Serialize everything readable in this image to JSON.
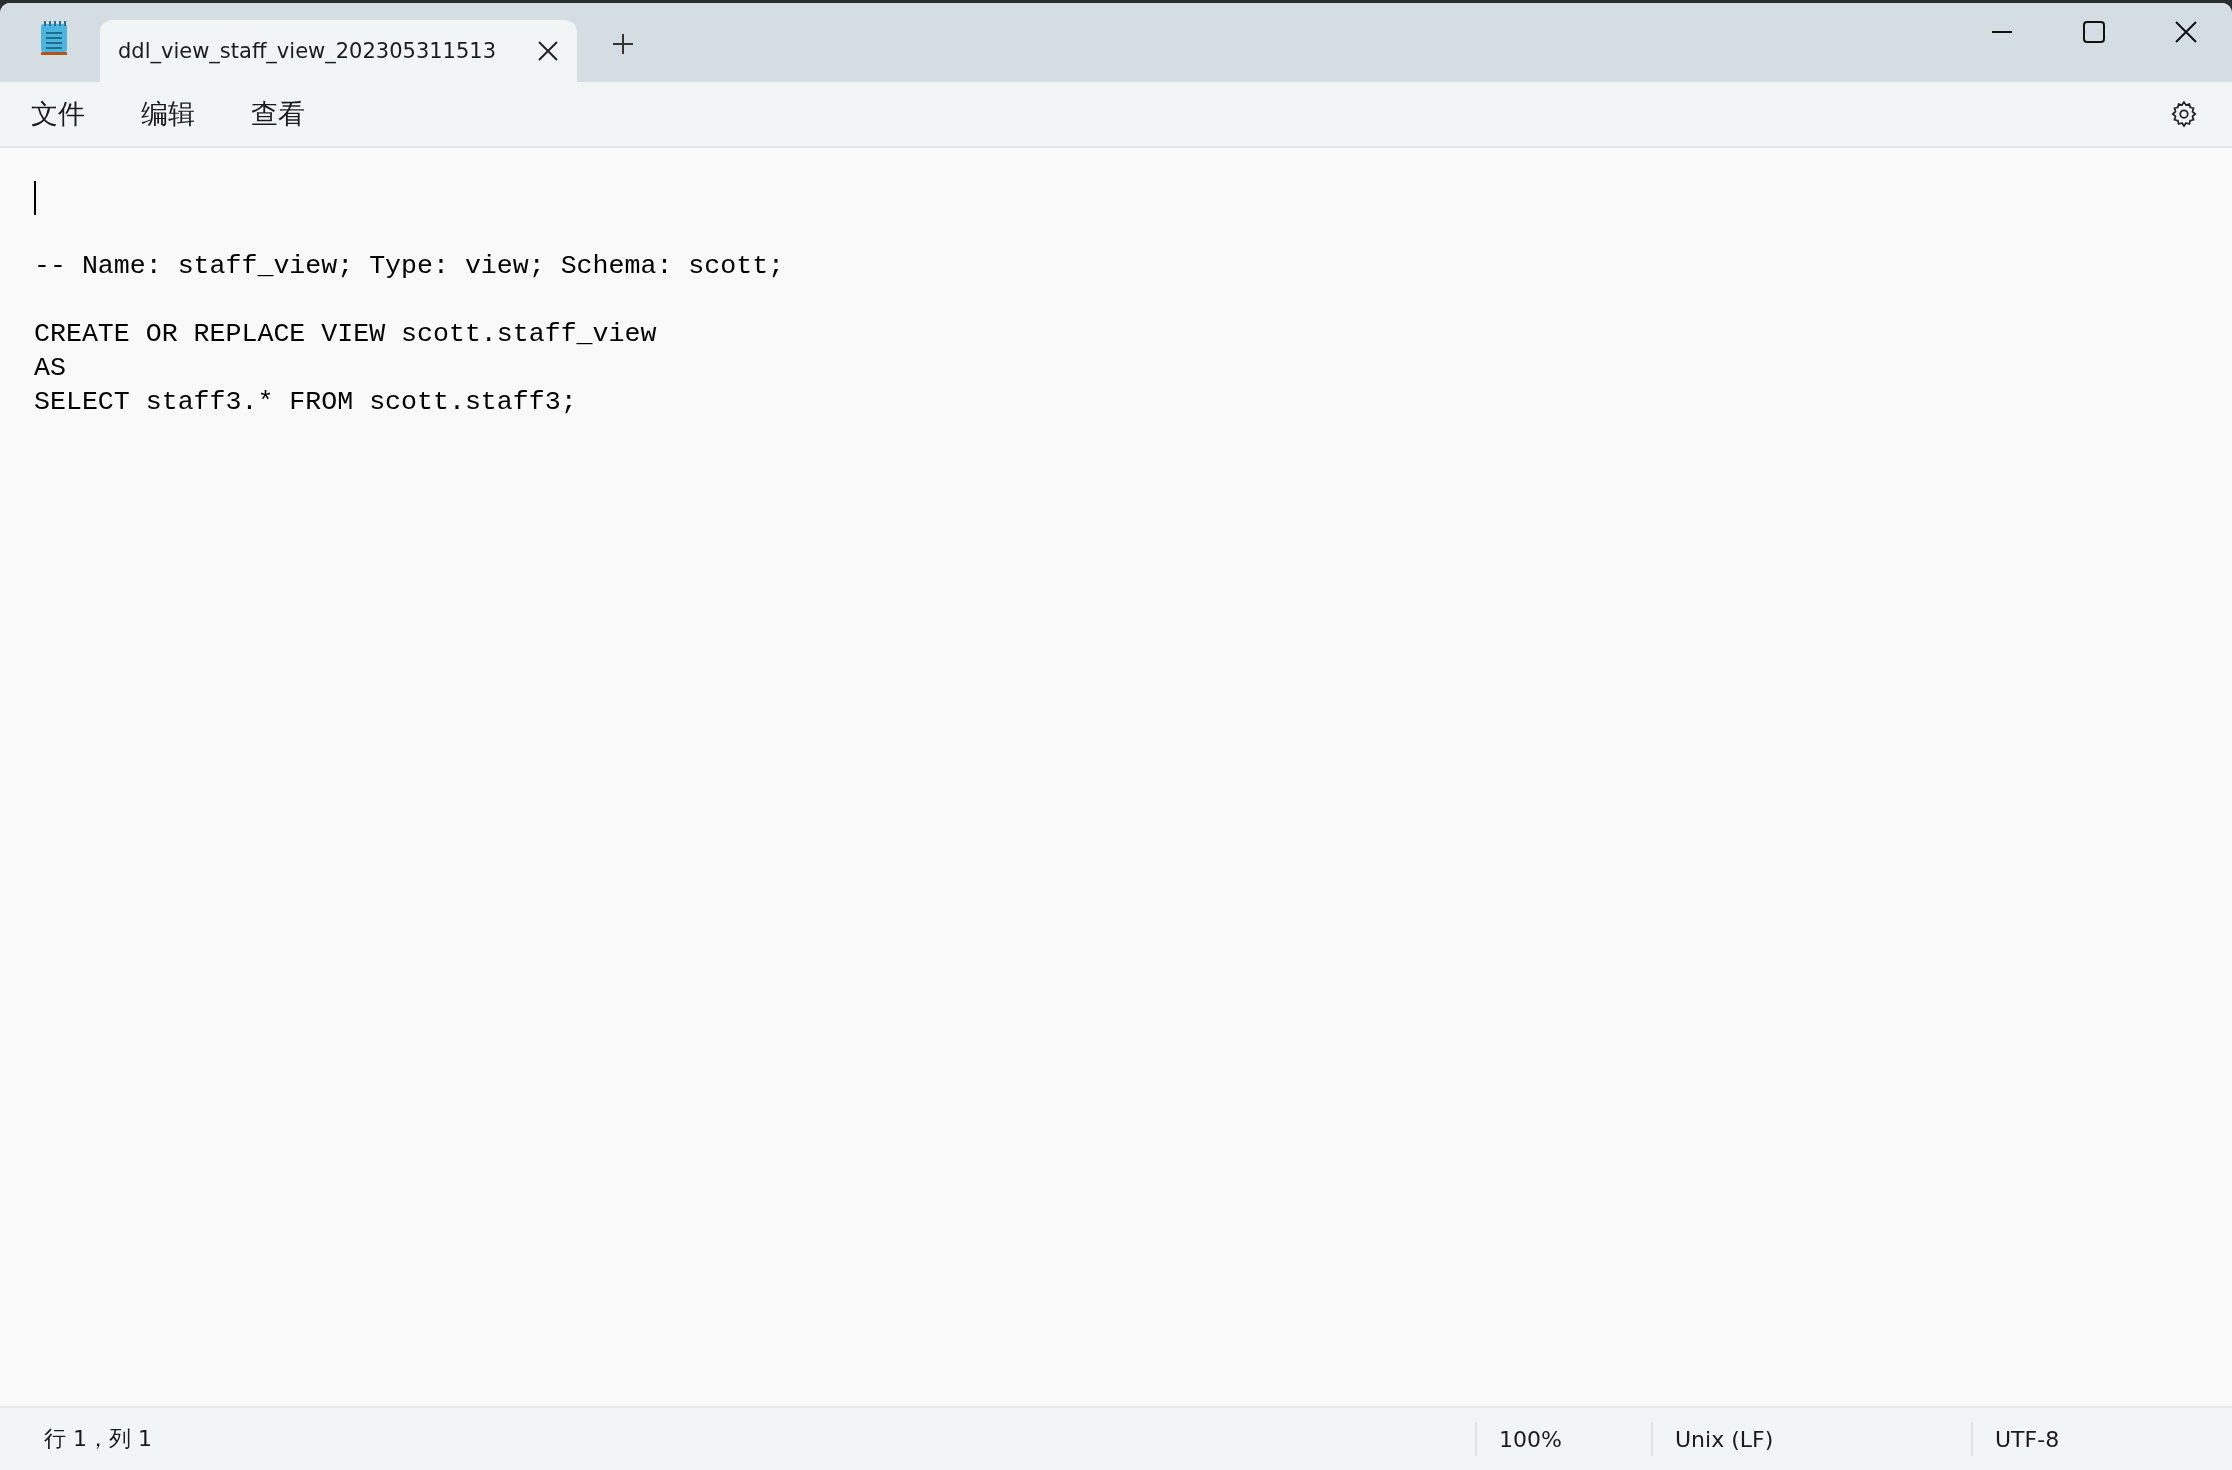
{
  "tabs": [
    {
      "title": "ddl_view_staff_view_202305311513",
      "selected": true
    }
  ],
  "menu": [
    "文件",
    "编辑",
    "查看"
  ],
  "editor": {
    "lines": [
      {
        "kind": "cursor"
      },
      {
        "kind": "blank"
      },
      {
        "kind": "code",
        "text": "-- Name: staff_view; Type: view; Schema: scott;"
      },
      {
        "kind": "blank"
      },
      {
        "kind": "code",
        "text": "CREATE OR REPLACE VIEW scott.staff_view"
      },
      {
        "kind": "code",
        "text": "AS"
      },
      {
        "kind": "code",
        "text": "SELECT staff3.* FROM scott.staff3;"
      }
    ]
  },
  "status_bar": {
    "position": "行 1，列 1",
    "zoom": "100%",
    "line_ending": "Unix (LF)",
    "encoding": "UTF-8"
  }
}
